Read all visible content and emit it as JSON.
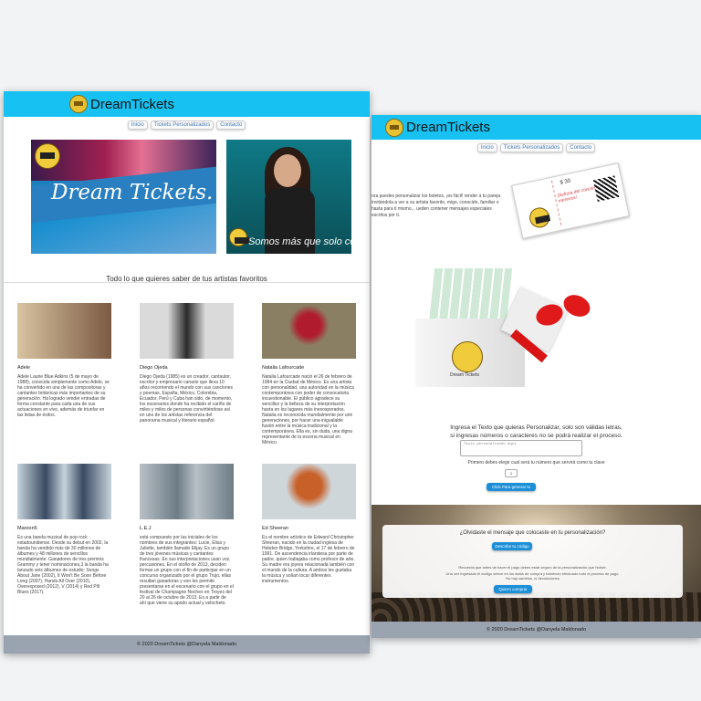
{
  "left": {
    "brand": "DreamTickets",
    "nav": [
      "Inicio",
      "Tickets Personalizados",
      "Contacto"
    ],
    "hero1_title": "Dream Tickets.",
    "hero2_slogan": "Somos más que solo co",
    "section_title": "Todo lo que quieres saber de tus artistas favoritos",
    "artists": [
      {
        "name": "Adele",
        "bio": "Adele Laurie Blue Adkins (5 de mayo de 1988), conocida simplemente como Adele, se ha convertido en una de las compositoras y cantantes británicas más importantes de su generación. Ha logrado vender entradas de forma constante para cada una de sus actuaciones en vivo, además de triunfar en las listas de éxitos.",
        "colors": [
          "#d8c3a0",
          "#7b5a43"
        ]
      },
      {
        "name": "Diego Ojeda",
        "bio": "Diego Ojeda (1985) es un creador, cantautor, escritor y empresario canario que lleva 10 años recorriendo el mundo con sus canciones y poemas. España, México, Colombia, Ecuador, Perú y Cuba han sido, de momento, los escenarios donde ha recibido el cariño de miles y miles de personas convirtiéndose así en uno de los artistas referencia del panorama musical y literario español.",
        "colors": [
          "#dadada",
          "#2b2b2b"
        ]
      },
      {
        "name": "Natalia Lafourcade",
        "bio": "Natalia Lafourcade nació el 26 de febrero de 1984 en la Ciudad de México. Es una artista con personalidad, una autoridad en la música contemporánea con poder de convocatoria incuestionable. El público agradece su sencillez y la belleza de su interpretación hasta en los lugares más inesosperados. Natalia es reconocida mundialmente por unir generaciones, por hacer una inigualable fusión entre la música tradicional y la contemporánea. Ella es, sin duda, una digna representante de la escena musical en México.",
        "colors": [
          "#8a7f62",
          "#b01c2e"
        ]
      },
      {
        "name": "Maroon5",
        "bio": "Es una banda musical de pop rock estadounidense. Desde su debut en 2002, la banda ha vendido más de 30 millones de álbumes y 48 millones de sencillos mundialmente. Ganadores de tres premios Grammy y tener nominaciones,3 la banda ha lanzado seis álbumes de estudio: Songs About Jane (2002), It Won't Be Soon Before Long (2007), Hands All Over (2010), Overexposed (2012), V (2014) y Red Pill Blues (2017).",
        "colors": [
          "#c7d3dc",
          "#3a4a63"
        ]
      },
      {
        "name": "L.E.J",
        "bio": "está compuesto por las iniciales de los nombres de sus integrantes: Lucie, Elisa y Juliette, también llamado Elijay. Es un grupo de tres jóvenes músicas y cantantes francesas. En sus interpretaciones usan voz, percusiones. En el otoño de 2013, deciden formar un grupo con el fin de participar en un concurso organizado por el grupo Trujo, ellas resultan ganadoras y eso les permite presentarse en el escenario con el grupo en el festival de Champagne Noches en Troyes del 20 al 26 de octubre de 2013. Es a partir de ahí que viene su apodo actual y velocheto.",
        "colors": [
          "#b8c0c6",
          "#6d7c86"
        ]
      },
      {
        "name": "Ed Sheeran",
        "bio": "Es el nombre artístico de Edward Christopher Sheeran, nacido en la ciudad inglesa de Hebden Bridge, Yorkshire, el 17 de febrero de 1991. De ascendencia irlandesa por parte de padre, quien trabajaba como profesor de arte. Su madre era joyera relacionada también con el mundo de la cultura. A ambos les gustaba la música y solían tocar diferentes instrumentos.",
        "colors": [
          "#cfd6da",
          "#c8602a"
        ]
      }
    ],
    "footer": "© 2020 DreamTickets @Danyela Maldonado"
  },
  "right": {
    "brand": "DreamTickets",
    "nav": [
      "Inicio",
      "Tickets Personalizados",
      "Contacto"
    ],
    "intro": "ora puedes personalizar los boletos, ¡es fácil! render a tu pareja invitándola a ver a su artista favorito, migo, conocido, familiar o hasta para ti mismo... ueden contener mensajes especiales escritos por ti.",
    "ticket_price": "$ 30",
    "ticket_message": "Disfruta del concierto, ¡Te lo mereces!",
    "box_brand": "Dream Tickets",
    "prompt_line1": "Ingresa el Texto que quieras Personalizar, solo son válidas letras,",
    "prompt_line2": "si ingresas números o caracteres no se podrá realizar el proceso.",
    "text_placeholder": "Texto personalizado aquí",
    "select_label": "Primero debes elegir cual será tu número que servirá como tu clave",
    "select_value": "1",
    "generate_button": "Click Para generar tu código",
    "card_question": "¿Olvidaste el mensaje que colocaste en tu personalización?",
    "describe_button": "Describe tu código",
    "note1": "Recuerda que antes de hacer el pago debes estar seguro de la personalización que hiciste.",
    "note2": "Una vez ingresado el código ofrece en los datos de compra y habiendo efectuado todo el proceso de pago.",
    "note3": "No hay cambios, ni devoluciones",
    "buy_button": "Quiero comprar",
    "footer": "© 2020 DreamTickets @Danyela Maldonado"
  }
}
